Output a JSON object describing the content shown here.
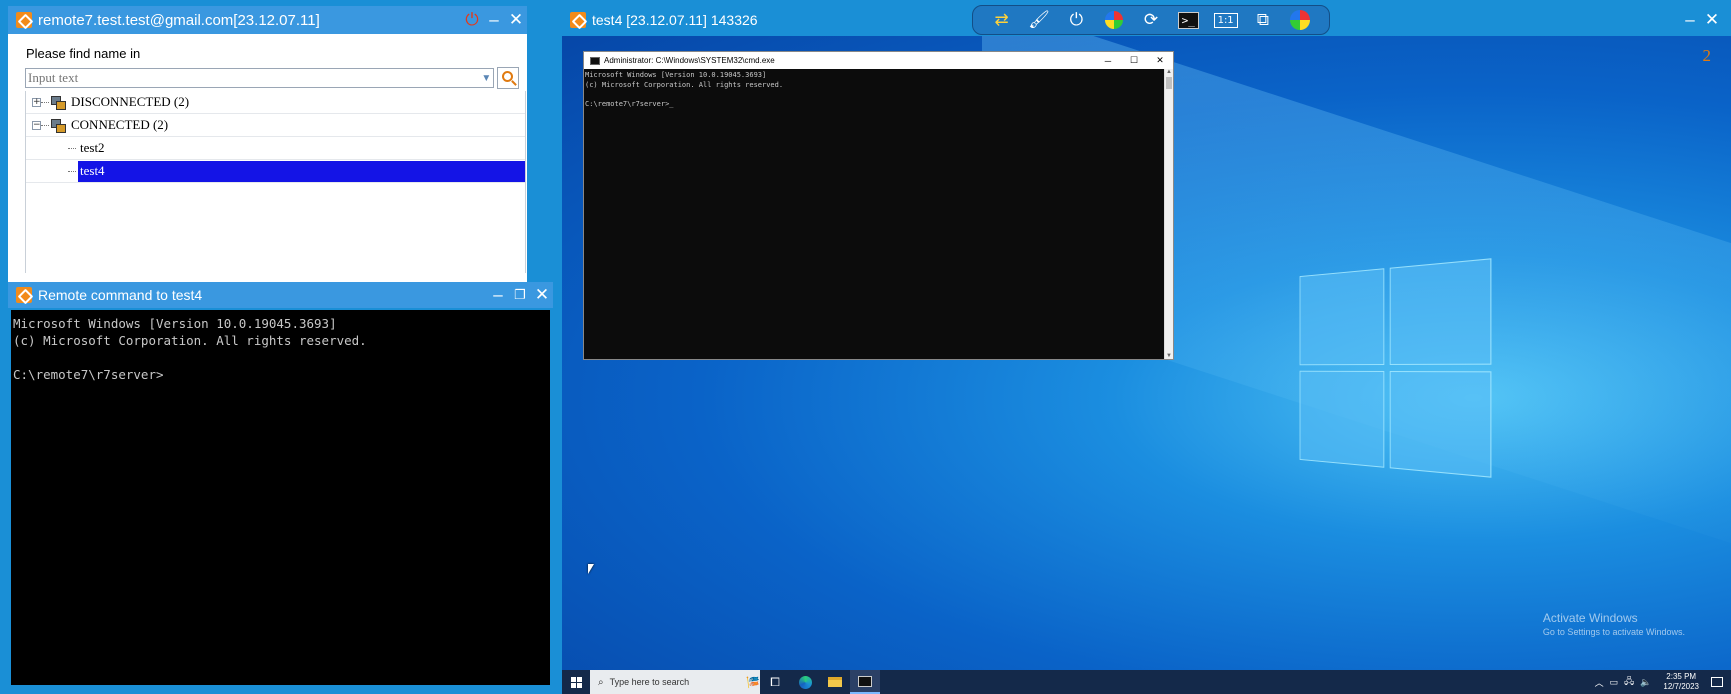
{
  "left_window": {
    "title": "remote7.test.test@gmail.com[23.12.07.11]",
    "find_label": "Please find name in",
    "search": {
      "placeholder": "Input text",
      "value": ""
    },
    "tree": {
      "groups": [
        {
          "expander": "+",
          "label": "DISCONNECTED (2)"
        },
        {
          "expander": "−",
          "label": "CONNECTED (2)"
        }
      ],
      "children": [
        "test2",
        "test4"
      ],
      "selected": "test4"
    }
  },
  "cmd_window": {
    "title": "Remote command to test4",
    "output": "Microsoft Windows [Version 10.0.19045.3693]\n(c) Microsoft Corporation. All rights reserved.\n\nC:\\remote7\\r7server>"
  },
  "remote_window": {
    "title": "test4 [23.12.07.11] 143326",
    "toolbar_ratio": "1:1",
    "toolbar_cmd": ">_",
    "page_number": "2",
    "inner_cmd": {
      "title": "Administrator: C:\\Windows\\SYSTEM32\\cmd.exe",
      "output": "Microsoft Windows [Version 10.0.19045.3693]\n(c) Microsoft Corporation. All rights reserved.\n\nC:\\remote7\\r7server>_"
    },
    "activate_title": "Activate Windows",
    "activate_sub": "Go to Settings to activate Windows.",
    "taskbar": {
      "search_placeholder": "Type here to search",
      "time": "2:35 PM",
      "date": "12/7/2023"
    }
  },
  "colors": {
    "accent": "#1a8fd6",
    "selection": "#1414e6",
    "power": "#e33a1a"
  }
}
